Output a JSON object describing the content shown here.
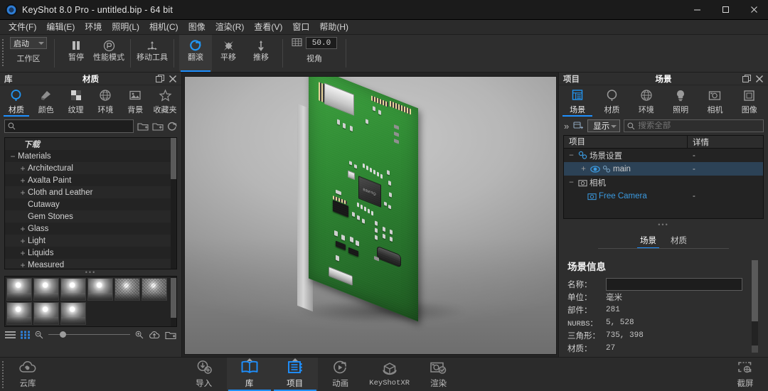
{
  "window": {
    "title": "KeyShot 8.0 Pro  - untitled.bip  - 64 bit",
    "minimize": "—",
    "maximize": "☐",
    "close": "✕"
  },
  "menubar": {
    "items": [
      "文件(F)",
      "编辑(E)",
      "环境",
      "照明(L)",
      "相机(C)",
      "图像",
      "渲染(R)",
      "查看(V)",
      "窗口",
      "帮助(H)"
    ]
  },
  "toolbar": {
    "workspace": {
      "value": "启动",
      "label": "工作区"
    },
    "buttons": [
      {
        "label": "暂停",
        "icon": "pause-icon",
        "active": false
      },
      {
        "label": "性能模式",
        "icon": "performance-mode-icon",
        "active": false
      },
      {
        "label": "移动工具",
        "icon": "move-tool-icon",
        "active": false
      },
      {
        "label": "翻滚",
        "icon": "tumble-icon",
        "active": true
      },
      {
        "label": "平移",
        "icon": "pan-icon",
        "active": false
      },
      {
        "label": "推移",
        "icon": "dolly-icon",
        "active": false
      }
    ],
    "fov": {
      "value": "50.0",
      "label": "视角",
      "icon": "perspective-icon"
    }
  },
  "library": {
    "header_left": "库",
    "header_title": "材质",
    "undock_icon": "undock-icon",
    "close_icon": "close-icon",
    "tabs": [
      {
        "label": "材质",
        "icon": "material-sphere-icon",
        "selected": true
      },
      {
        "label": "颜色",
        "icon": "color-swatch-icon",
        "selected": false
      },
      {
        "label": "纹理",
        "icon": "texture-checker-icon",
        "selected": false
      },
      {
        "label": "环境",
        "icon": "environment-globe-icon",
        "selected": false
      },
      {
        "label": "背景",
        "icon": "background-image-icon",
        "selected": false
      },
      {
        "label": "收藏夹",
        "icon": "favorites-star-icon",
        "selected": false
      }
    ],
    "search": {
      "placeholder": "",
      "value": "",
      "icon": "search-icon"
    },
    "search_actions": [
      "folder-add-icon",
      "folder-import-icon",
      "refresh-icon"
    ],
    "tree": [
      {
        "label": "下载",
        "indent": 1,
        "expander": "",
        "italic": true
      },
      {
        "label": "Materials",
        "indent": 0,
        "expander": "−",
        "italic": false
      },
      {
        "label": "Architectural",
        "indent": 1,
        "expander": "+",
        "italic": false
      },
      {
        "label": "Axalta Paint",
        "indent": 1,
        "expander": "+",
        "italic": false
      },
      {
        "label": "Cloth and Leather",
        "indent": 1,
        "expander": "+",
        "italic": false
      },
      {
        "label": "Cutaway",
        "indent": 1,
        "expander": "",
        "italic": false
      },
      {
        "label": "Gem Stones",
        "indent": 1,
        "expander": "",
        "italic": false
      },
      {
        "label": "Glass",
        "indent": 1,
        "expander": "+",
        "italic": false
      },
      {
        "label": "Light",
        "indent": 1,
        "expander": "+",
        "italic": false
      },
      {
        "label": "Liquids",
        "indent": 1,
        "expander": "+",
        "italic": false
      },
      {
        "label": "Measured",
        "indent": 1,
        "expander": "+",
        "italic": false
      }
    ],
    "thumbnail_count": 9,
    "bottom_bar": {
      "list_view_icon": "list-view-icon",
      "grid_view_icon": "grid-view-icon",
      "zoom_out_icon": "zoom-out-icon",
      "zoom_in_icon": "zoom-in-icon",
      "upload_icon": "cloud-upload-icon",
      "folder_icon": "folder-open-icon",
      "slider_value": "15"
    }
  },
  "project": {
    "header_left": "项目",
    "header_title": "场景",
    "undock_icon": "undock-icon",
    "close_icon": "close-icon",
    "tabs": [
      {
        "label": "场景",
        "icon": "scene-tree-icon",
        "selected": true
      },
      {
        "label": "材质",
        "icon": "material-sphere-icon",
        "selected": false
      },
      {
        "label": "环境",
        "icon": "environment-globe-icon",
        "selected": false
      },
      {
        "label": "照明",
        "icon": "lighting-bulb-icon",
        "selected": false
      },
      {
        "label": "相机",
        "icon": "camera-icon",
        "selected": false
      },
      {
        "label": "图像",
        "icon": "image-icon",
        "selected": false
      }
    ],
    "toolrow": {
      "chevron_icon": "chevron-right-icon",
      "collapse_icon": "collapse-tree-icon",
      "display_button": "显示",
      "search": {
        "placeholder": "搜索全部",
        "value": "",
        "icon": "search-icon"
      }
    },
    "tree_headers": {
      "item": "项目",
      "detail": "详情"
    },
    "tree_rows": [
      {
        "label": "场景设置",
        "detail": "-",
        "expander": "−",
        "indent": 0,
        "icon": "scene-set-icon",
        "selected": false
      },
      {
        "label": "main",
        "detail": "-",
        "expander": "+",
        "indent": 1,
        "icon": "eye-icon",
        "selected": true
      },
      {
        "label": "相机",
        "detail": "",
        "expander": "−",
        "indent": 0,
        "icon": "camera-icon",
        "selected": false
      },
      {
        "label": "Free Camera",
        "detail": "-",
        "expander": "",
        "indent": 2,
        "icon": "camera-icon",
        "selected": false
      }
    ],
    "subtabs": [
      {
        "label": "场景",
        "selected": true
      },
      {
        "label": "材质",
        "selected": false
      }
    ],
    "scene_info": {
      "title": "场景信息",
      "rows": [
        {
          "key": "名称：",
          "value": "",
          "field": true
        },
        {
          "key": "单位：",
          "value": "毫米",
          "field": false
        },
        {
          "key": "部件：",
          "value": "281",
          "field": false
        },
        {
          "key": "NURBS：",
          "value": "5, 528",
          "field": false,
          "mono_key": true
        },
        {
          "key": "三角形：",
          "value": "735, 398",
          "field": false
        },
        {
          "key": "材质：",
          "value": "27",
          "field": false
        }
      ]
    }
  },
  "dock": {
    "left": [
      {
        "label": "云库",
        "icon": "cloud-library-icon",
        "active": false
      }
    ],
    "center": [
      {
        "label": "导入",
        "icon": "import-icon",
        "active": false
      },
      {
        "label": "库",
        "icon": "library-book-icon",
        "active": true
      },
      {
        "label": "项目",
        "icon": "project-list-icon",
        "active": true
      },
      {
        "label": "动画",
        "icon": "animation-icon",
        "active": false
      },
      {
        "label": "KeyShotXR",
        "icon": "keyshotxr-icon",
        "active": false
      },
      {
        "label": "渲染",
        "icon": "render-icon",
        "active": false
      }
    ],
    "right": [
      {
        "label": "截屏",
        "icon": "screenshot-icon",
        "active": false
      }
    ]
  },
  "viewport": {
    "model_name": "pcb-circuit-board",
    "chip_label": "QFN88",
    "background_color": "#aaaaaa"
  },
  "colors": {
    "accent": "#1e90ff",
    "panel_bg": "#2e2e2e",
    "titlebar_bg": "#1b1b1b",
    "pcb_green": "#2f8a33",
    "selected_row": "#2c4256"
  }
}
